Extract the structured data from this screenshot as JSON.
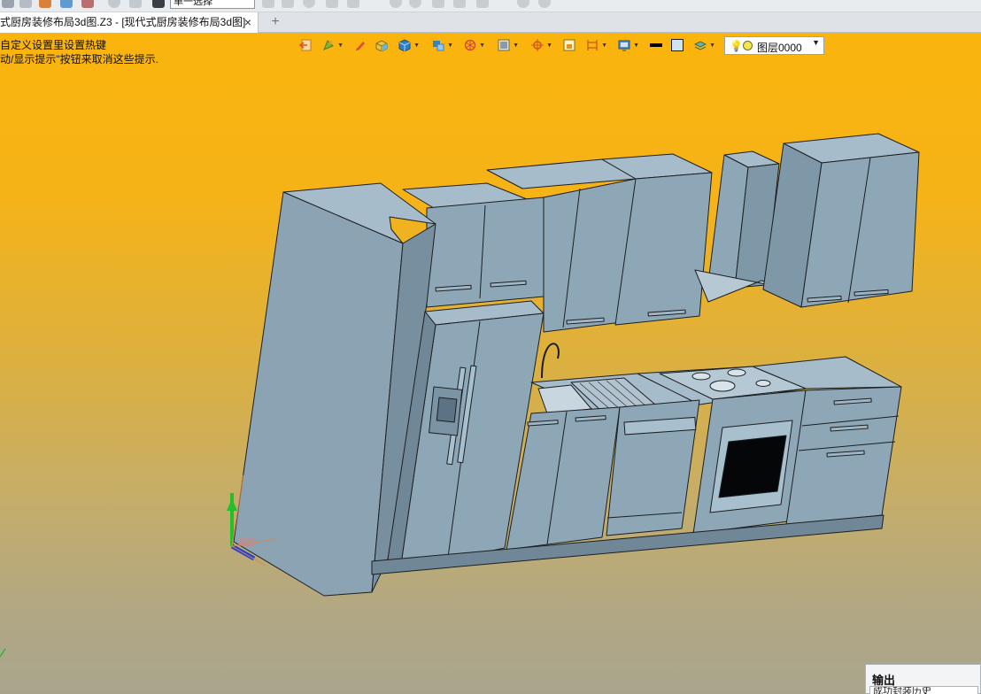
{
  "top_toolbar": {
    "selection_mode": "单一选择"
  },
  "tab": {
    "title": "式厨房装修布局3d图.Z3 - [现代式厨房装修布局3d图]",
    "close_icon": "×",
    "new_tab_icon": "+"
  },
  "viewport": {
    "hint_line_1": "自定义设置里设置热键",
    "hint_line_2": "动/显示提示\"按钮来取消这些提示.",
    "background_top": "#fbb40c",
    "background_bottom": "#a9a58d",
    "model_color": "#8fa6b5"
  },
  "floating_toolbar": {
    "icons": [
      "exit-sketch-icon",
      "shade-icon",
      "pen-icon",
      "box-icon",
      "solid-view-icon",
      "render-mode-icon",
      "section-icon",
      "display-filter-icon",
      "snap-icon",
      "frame-icon",
      "dimension-icon",
      "screen-icon",
      "line-color-icon",
      "face-color-icon",
      "layer-manager-icon"
    ],
    "layer_name": "图层0000"
  },
  "output_panel": {
    "title": "输出",
    "message": "成功封装历史"
  }
}
